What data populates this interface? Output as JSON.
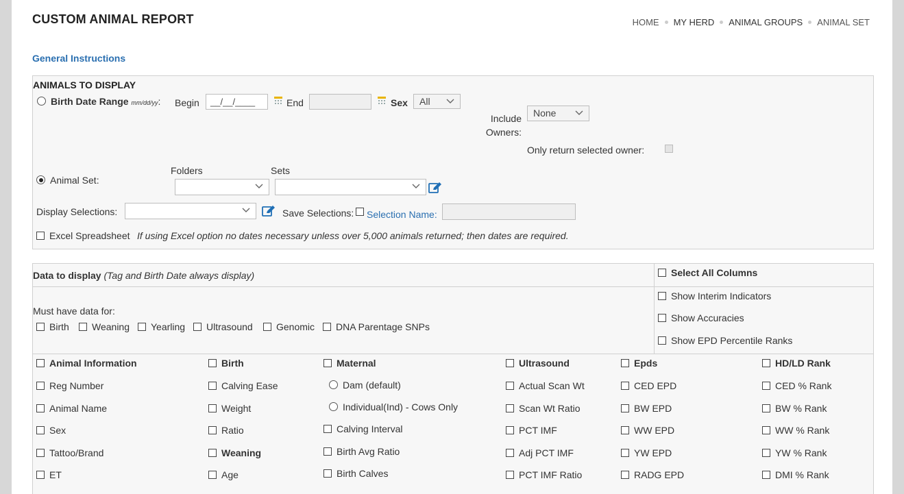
{
  "header": {
    "title": "CUSTOM ANIMAL REPORT",
    "breadcrumbs": [
      "HOME",
      "MY HERD",
      "ANIMAL GROUPS",
      "ANIMAL SET"
    ]
  },
  "instructions_link": "General Instructions",
  "animals_to_display": {
    "heading": "ANIMALS TO DISPLAY",
    "birth_date_range": {
      "label": "Birth Date Range",
      "format_hint": "mm/dd/yy",
      "colon": ":",
      "begin_label": "Begin",
      "begin_value": "__/__/____",
      "end_label": "End",
      "end_value": ""
    },
    "sex": {
      "label": "Sex",
      "value": "All"
    },
    "include_owners": {
      "label_line1": "Include",
      "label_line2": "Owners:",
      "value": "None"
    },
    "only_selected_owner_label": "Only return selected owner:",
    "animal_set": {
      "label": "Animal Set:",
      "folders_label": "Folders",
      "sets_label": "Sets",
      "folders_value": "",
      "sets_value": ""
    },
    "display_selections": {
      "label": "Display Selections:",
      "value": ""
    },
    "save_selections_label": "Save Selections:",
    "selection_name_label": "Selection Name:",
    "selection_name_value": "",
    "excel_label": "Excel Spreadsheet",
    "excel_note": "If using Excel option no dates necessary unless over 5,000 animals returned; then dates are required."
  },
  "data_to_display": {
    "heading": "Data to display",
    "heading_note": "(Tag and Birth Date always display)",
    "select_all": "Select All Columns",
    "must_have_label": "Must have data for:",
    "must_have": [
      "Birth",
      "Weaning",
      "Yearling",
      "Ultrasound",
      "Genomic",
      "DNA Parentage SNPs"
    ],
    "options": [
      "Show Interim Indicators",
      "Show Accuracies",
      "Show EPD Percentile Ranks"
    ]
  },
  "columns": {
    "animal_info": {
      "header": "Animal Information",
      "items": [
        "Reg Number",
        "Animal Name",
        "Sex",
        "Tattoo/Brand",
        "ET"
      ]
    },
    "birth": {
      "header": "Birth",
      "items": [
        "Calving Ease",
        "Weight",
        "Ratio"
      ]
    },
    "weaning": {
      "header": "Weaning",
      "items": [
        "Age"
      ]
    },
    "maternal": {
      "header": "Maternal",
      "radios": [
        "Dam (default)",
        "Individual(Ind) - Cows Only"
      ],
      "items": [
        "Calving Interval",
        "Birth Avg Ratio",
        "Birth Calves"
      ]
    },
    "ultrasound": {
      "header": "Ultrasound",
      "items": [
        "Actual Scan Wt",
        "Scan Wt Ratio",
        "PCT IMF",
        "Adj PCT IMF",
        "PCT IMF Ratio"
      ]
    },
    "epds": {
      "header": "Epds",
      "items": [
        "CED EPD",
        "BW EPD",
        "WW EPD",
        "YW EPD",
        "RADG EPD"
      ]
    },
    "hdld": {
      "header": "HD/LD Rank",
      "items": [
        "CED % Rank",
        "BW % Rank",
        "WW % Rank",
        "YW % Rank",
        "DMI % Rank"
      ]
    }
  },
  "colors": {
    "accent": "#2a6fb0",
    "panel_bg": "#f7f7f7",
    "border": "#d0d0d0",
    "icon_blue": "#1f6fb5",
    "calendar": "#e8b400"
  }
}
